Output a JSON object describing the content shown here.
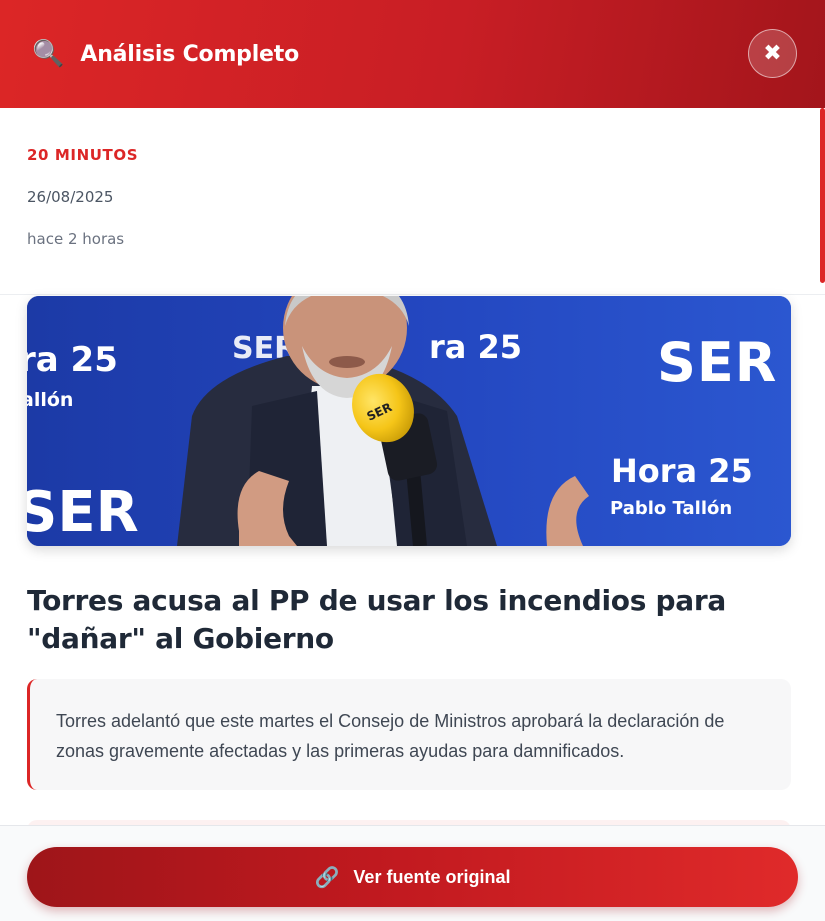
{
  "header": {
    "icon": "magnifier-icon",
    "title": "Análisis Completo",
    "close_icon": "close-icon"
  },
  "article": {
    "source": "20 MINUTOS",
    "date": "26/08/2025",
    "relative_time": "hace 2 horas",
    "image_alt": "Man speaking into a yellow SER microphone in the Hora 25 studio",
    "image_texts": {
      "brand_top": "SER",
      "program_top_left": "ra 25",
      "program_top_center": "ra 25",
      "host_left": "allón",
      "program_right": "Hora 25",
      "host_right": "Pablo Tallón",
      "brand_bottom": "SER",
      "mic_label": "SER"
    },
    "headline": "Torres acusa al PP de usar los incendios para \"dañar\" al Gobierno",
    "summary": "Torres adelantó que este martes el Consejo de Ministros aprobará la declaración de zonas gravemente afectadas y las primeras ayudas para damnificados."
  },
  "footer": {
    "button_icon": "link-icon",
    "button_label": "Ver fuente original"
  },
  "colors": {
    "accent": "#dc2626",
    "header_dark": "#a3151b",
    "studio_blue": "#2347c0",
    "mic_yellow": "#f5c518"
  }
}
